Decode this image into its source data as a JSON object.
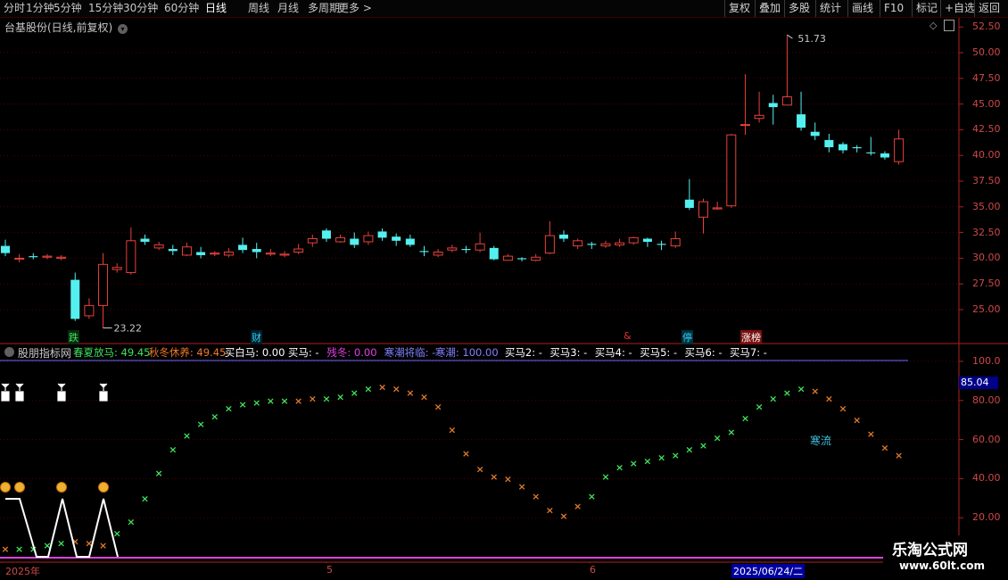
{
  "toolbar": {
    "tabs": [
      "分时",
      "1分钟",
      "5分钟",
      "15分钟",
      "30分钟",
      "60分钟",
      "日线",
      "周线",
      "月线",
      "多周期",
      "更多 >"
    ],
    "active_tab": "日线",
    "right_buttons": [
      "复权",
      "叠加",
      "多股",
      "统计",
      "画线",
      "F10",
      "标记",
      "+自选",
      "返回"
    ]
  },
  "chart_title": "台基股份(日线,前复权)",
  "indicator_title": "股朋指标网",
  "legend": [
    {
      "label": "春夏放马: 49.45",
      "color": "#3ee35a"
    },
    {
      "label": "秋冬休养: 49.45",
      "color": "#f07a24"
    },
    {
      "label": "买白马: 0.00",
      "color": "#ffffff"
    },
    {
      "label": "买马: -",
      "color": "#ffffff"
    },
    {
      "label": "残冬: 0.00",
      "color": "#e040e0"
    },
    {
      "label": "寒潮将临: -",
      "color": "#8080ff"
    },
    {
      "label": "寒潮: 100.00",
      "color": "#8080ff"
    },
    {
      "label": "买马2: -",
      "color": "#ffffff"
    },
    {
      "label": "买马3: -",
      "color": "#ffffff"
    },
    {
      "label": "买马4: -",
      "color": "#ffffff"
    },
    {
      "label": "买马5: -",
      "color": "#ffffff"
    },
    {
      "label": "买马6: -",
      "color": "#ffffff"
    },
    {
      "label": "买马7: -",
      "color": "#ffffff"
    }
  ],
  "price_axis": [
    "52.50",
    "50.00",
    "47.50",
    "45.00",
    "42.50",
    "40.00",
    "37.50",
    "35.00",
    "32.50",
    "30.00",
    "27.50",
    "25.00"
  ],
  "ind_axis": [
    "100.0",
    "80.00",
    "60.00",
    "40.00",
    "20.00"
  ],
  "ind_current": "85.04",
  "annotations": {
    "high": "51.73",
    "low": "23.22",
    "cold_label": "寒流"
  },
  "events": [
    {
      "text": "跌",
      "color": "#3ee35a",
      "bg": "#0a2a10"
    },
    {
      "text": "财",
      "color": "#30d0ff",
      "bg": "#00202a"
    },
    {
      "text": "&",
      "color": "#e03030",
      "bg": "#000"
    },
    {
      "text": "停",
      "color": "#30d0ff",
      "bg": "#00303a"
    },
    {
      "text": "涨榜",
      "color": "#ffffff",
      "bg": "#7a1010"
    }
  ],
  "dates": [
    "2025年",
    "5",
    "6",
    "2025/06/24/二"
  ],
  "watermark": {
    "line1": "乐淘公式网",
    "line2": "www.60lt.com"
  },
  "chart_data": {
    "type": "candlestick",
    "candles": [
      [
        31.2,
        30.5,
        31.8,
        30.2
      ],
      [
        30.0,
        30.0,
        30.4,
        29.6
      ],
      [
        30.2,
        30.1,
        30.5,
        29.9
      ],
      [
        30.1,
        30.2,
        30.4,
        29.9
      ],
      [
        30.0,
        30.1,
        30.3,
        29.8
      ],
      [
        27.9,
        24.1,
        28.6,
        23.9
      ],
      [
        24.4,
        25.4,
        26.1,
        24.1
      ],
      [
        25.4,
        29.4,
        30.5,
        23.2
      ],
      [
        28.9,
        29.1,
        29.5,
        28.6
      ],
      [
        28.6,
        31.7,
        33.0,
        28.4
      ],
      [
        31.9,
        31.6,
        32.3,
        31.3
      ],
      [
        31.0,
        31.3,
        31.6,
        30.8
      ],
      [
        30.9,
        30.7,
        31.3,
        30.3
      ],
      [
        30.3,
        31.1,
        31.5,
        30.2
      ],
      [
        30.6,
        30.3,
        31.1,
        30.0
      ],
      [
        30.4,
        30.5,
        30.7,
        30.2
      ],
      [
        30.3,
        30.6,
        31.0,
        30.1
      ],
      [
        31.3,
        30.8,
        32.0,
        30.5
      ],
      [
        30.9,
        30.6,
        31.5,
        30.0
      ],
      [
        30.4,
        30.5,
        30.9,
        30.2
      ],
      [
        30.3,
        30.4,
        30.7,
        30.1
      ],
      [
        30.6,
        30.9,
        31.4,
        30.4
      ],
      [
        31.5,
        31.9,
        32.3,
        31.1
      ],
      [
        32.7,
        31.9,
        32.9,
        31.6
      ],
      [
        31.6,
        32.0,
        32.3,
        31.5
      ],
      [
        31.9,
        31.3,
        32.5,
        31.0
      ],
      [
        31.6,
        32.2,
        32.6,
        31.3
      ],
      [
        32.6,
        32.0,
        32.9,
        31.7
      ],
      [
        32.1,
        31.7,
        32.4,
        31.2
      ],
      [
        31.9,
        31.3,
        32.3,
        31.1
      ],
      [
        30.7,
        30.6,
        31.2,
        30.2
      ],
      [
        30.3,
        30.6,
        30.9,
        30.1
      ],
      [
        30.8,
        31.0,
        31.3,
        30.6
      ],
      [
        30.9,
        30.8,
        31.2,
        30.5
      ],
      [
        30.8,
        31.4,
        32.5,
        30.6
      ],
      [
        31.0,
        29.9,
        31.2,
        29.8
      ],
      [
        29.8,
        30.2,
        30.4,
        29.8
      ],
      [
        30.0,
        29.9,
        30.1,
        29.7
      ],
      [
        29.8,
        30.1,
        30.4,
        29.7
      ],
      [
        30.5,
        32.2,
        33.6,
        30.4
      ],
      [
        32.3,
        31.9,
        32.7,
        31.6
      ],
      [
        31.2,
        31.7,
        31.9,
        30.9
      ],
      [
        31.4,
        31.3,
        31.6,
        30.9
      ],
      [
        31.2,
        31.4,
        31.7,
        31.0
      ],
      [
        31.3,
        31.5,
        31.9,
        31.1
      ],
      [
        31.5,
        32.0,
        32.1,
        31.3
      ],
      [
        31.9,
        31.6,
        32.0,
        31.1
      ],
      [
        31.4,
        31.3,
        31.7,
        30.8
      ],
      [
        31.2,
        31.9,
        32.6,
        31.0
      ],
      [
        35.7,
        34.9,
        37.7,
        34.7
      ],
      [
        34.0,
        35.5,
        35.8,
        32.4
      ],
      [
        34.8,
        34.9,
        35.5,
        34.7
      ],
      [
        35.1,
        42.0,
        42.1,
        34.9
      ],
      [
        43.0,
        43.0,
        47.9,
        42.0
      ],
      [
        43.6,
        43.9,
        46.2,
        43.2
      ],
      [
        45.1,
        44.7,
        45.9,
        43.0
      ],
      [
        44.9,
        45.7,
        51.7,
        44.9
      ],
      [
        44.0,
        42.7,
        46.2,
        42.4
      ],
      [
        42.3,
        41.9,
        43.2,
        41.5
      ],
      [
        41.5,
        40.8,
        42.1,
        40.3
      ],
      [
        41.1,
        40.5,
        41.3,
        40.2
      ],
      [
        40.8,
        40.7,
        41.0,
        40.3
      ],
      [
        40.3,
        40.2,
        41.8,
        40.0
      ],
      [
        40.2,
        39.8,
        40.4,
        39.6
      ],
      [
        39.4,
        41.6,
        42.5,
        39.1
      ]
    ],
    "indicator_x": [
      1,
      2,
      3,
      4,
      5,
      6,
      7,
      8,
      9,
      10,
      11,
      12,
      13,
      14,
      15,
      16,
      17,
      18,
      19,
      20,
      21,
      22,
      23,
      24,
      25,
      26,
      27,
      28,
      29,
      30,
      31,
      32,
      33,
      34,
      35,
      36,
      37,
      38,
      39,
      40,
      41,
      42,
      43,
      44,
      45,
      46,
      47,
      48,
      49,
      50,
      51,
      52,
      53,
      54,
      55,
      56,
      57,
      58,
      59,
      60,
      61,
      62,
      63,
      64,
      65
    ],
    "indicator_values": [
      4,
      4,
      4,
      6,
      7,
      8,
      7,
      6,
      12,
      18,
      30,
      43,
      55,
      62,
      68,
      72,
      76,
      78,
      79,
      80,
      80,
      80,
      81,
      81,
      82,
      84,
      86,
      87,
      86,
      84,
      82,
      77,
      65,
      53,
      45,
      41,
      40,
      36,
      31,
      24,
      21,
      26,
      31,
      41,
      46,
      48,
      49,
      51,
      52,
      55,
      57,
      61,
      64,
      71,
      77,
      81,
      84,
      86,
      85,
      81,
      76,
      70,
      63,
      56,
      52
    ],
    "indicator_colors": [
      "o",
      "g",
      "g",
      "g",
      "g",
      "o",
      "o",
      "o",
      "g",
      "g",
      "g",
      "g",
      "g",
      "g",
      "g",
      "g",
      "g",
      "g",
      "g",
      "g",
      "g",
      "o",
      "o",
      "g",
      "g",
      "g",
      "g",
      "o",
      "o",
      "o",
      "o",
      "o",
      "o",
      "o",
      "o",
      "o",
      "o",
      "o",
      "o",
      "o",
      "o",
      "o",
      "g",
      "g",
      "g",
      "g",
      "g",
      "g",
      "g",
      "g",
      "g",
      "g",
      "g",
      "g",
      "g",
      "g",
      "g",
      "g",
      "o",
      "o",
      "o",
      "o",
      "o",
      "o",
      "o"
    ],
    "buy_signal_x": [
      1,
      2,
      5,
      8
    ],
    "high_label": "51.73",
    "low_label": "23.22",
    "price_range": [
      22.0,
      53.5
    ],
    "indicator_range": [
      0,
      100
    ]
  }
}
